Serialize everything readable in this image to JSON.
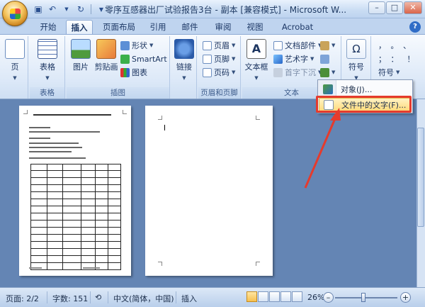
{
  "window": {
    "title": "零序互感器出厂试验报告3台 - 副本 [兼容模式] - Microsoft W...",
    "controls": {
      "minimize": "–",
      "maximize": "□",
      "close": "✕"
    }
  },
  "tabs": [
    "开始",
    "插入",
    "页面布局",
    "引用",
    "邮件",
    "审阅",
    "视图",
    "Acrobat"
  ],
  "active_tab": "插入",
  "ribbon": {
    "page": {
      "label": "页",
      "group": ""
    },
    "table": {
      "label": "表格",
      "group": "表格"
    },
    "illustrations": {
      "group": "插图",
      "picture": "图片",
      "clipart": "剪贴画",
      "shapes": "形状",
      "smartart": "SmartArt",
      "chart": "图表"
    },
    "links": {
      "label": "链接"
    },
    "header_footer": {
      "group": "页眉和页脚",
      "header": "页眉",
      "footer": "页脚",
      "page_number": "页码"
    },
    "text": {
      "group": "文本",
      "textbox": "文本框",
      "quickparts": "文档部件",
      "wordart": "艺术字",
      "dropcap": "首字下沉"
    },
    "symbols": {
      "label": "符号",
      "symbol_small": "符号",
      "equation": "Ω"
    }
  },
  "object_menu": {
    "items": [
      {
        "label": "对象(J)..."
      },
      {
        "label": "文件中的文字(F)..."
      }
    ]
  },
  "statusbar": {
    "page": "页面: 2/2",
    "words": "字数: 151",
    "language": "中文(简体，中国)",
    "mode": "插入",
    "zoom": "26%",
    "zoom_minus": "–",
    "zoom_plus": "+"
  },
  "colors": {
    "highlight": "#e53b2d",
    "doc_background": "#6485b4",
    "ribbon": "#dde9f8"
  }
}
